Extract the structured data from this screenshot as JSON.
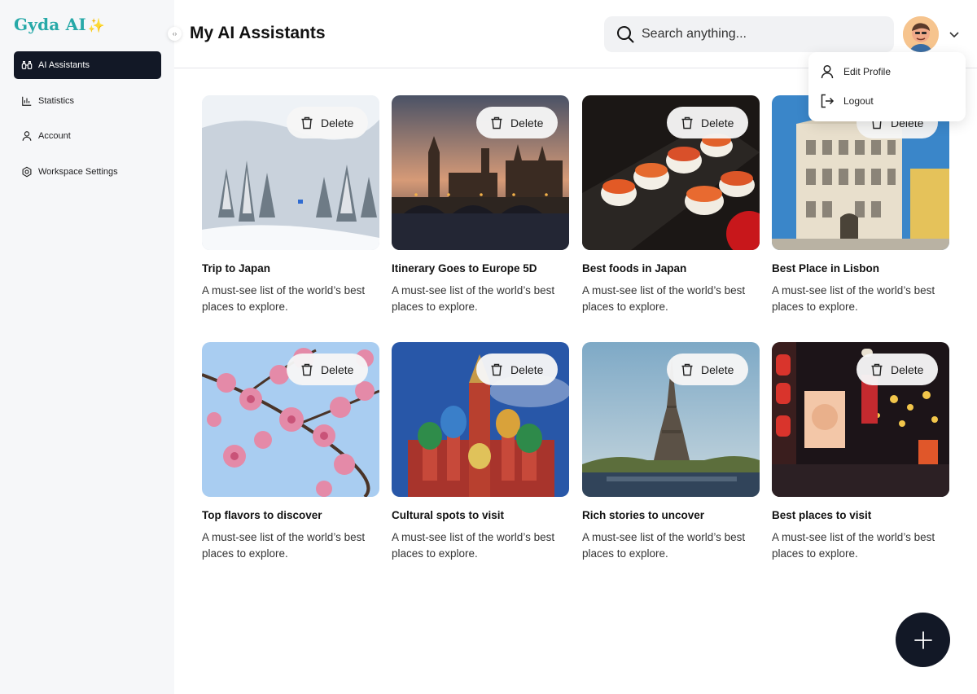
{
  "app": {
    "logo_text": "Gyda AI",
    "logo_spark": "✨",
    "accent": "#27a9a8",
    "nav_dark": "#121826"
  },
  "sidebar": {
    "items": [
      {
        "label": "AI Assistants",
        "icon": "binoculars-icon",
        "active": true
      },
      {
        "label": "Statistics",
        "icon": "bar-chart-icon",
        "active": false
      },
      {
        "label": "Account",
        "icon": "user-icon",
        "active": false
      },
      {
        "label": "Workspace Settings",
        "icon": "settings-hexagon-icon",
        "active": false
      }
    ],
    "collapse_glyph": "‹›"
  },
  "header": {
    "title": "My AI Assistants",
    "search_placeholder": "Search anything...",
    "avatar_icon": "avatar",
    "chevron_icon": "chevron-down-icon"
  },
  "profile_menu": {
    "items": [
      {
        "label": "Edit Profile",
        "icon": "user-icon"
      },
      {
        "label": "Logout",
        "icon": "logout-icon"
      }
    ]
  },
  "cards": [
    {
      "title": "Trip to Japan",
      "desc": "A must-see list of the world’s best places to explore.",
      "delete_label": "Delete",
      "image": "snowy-forest"
    },
    {
      "title": "Itinerary Goes to Europe 5D",
      "desc": "A must-see list of the world’s best places to explore.",
      "delete_label": "Delete",
      "image": "london-bridge-sunset"
    },
    {
      "title": "Best foods in Japan",
      "desc": "A must-see list of the world’s best places to explore.",
      "delete_label": "Delete",
      "image": "sushi-rolls"
    },
    {
      "title": "Best Place in Lisbon",
      "desc": "A must-see list of the world’s best places to explore.",
      "delete_label": "Delete",
      "image": "lisbon-building"
    },
    {
      "title": "Top flavors to discover",
      "desc": "A must-see list of the world’s best places to explore.",
      "delete_label": "Delete",
      "image": "cherry-blossoms"
    },
    {
      "title": "Cultural spots to visit",
      "desc": "A must-see list of the world’s best places to explore.",
      "delete_label": "Delete",
      "image": "saint-basils-cathedral"
    },
    {
      "title": "Rich stories to uncover",
      "desc": "A must-see list of the world’s best places to explore.",
      "delete_label": "Delete",
      "image": "eiffel-tower"
    },
    {
      "title": "Best places to visit",
      "desc": "A must-see list of the world’s best places to explore.",
      "delete_label": "Delete",
      "image": "tokyo-neon-street"
    }
  ],
  "fab": {
    "icon": "plus-icon"
  }
}
